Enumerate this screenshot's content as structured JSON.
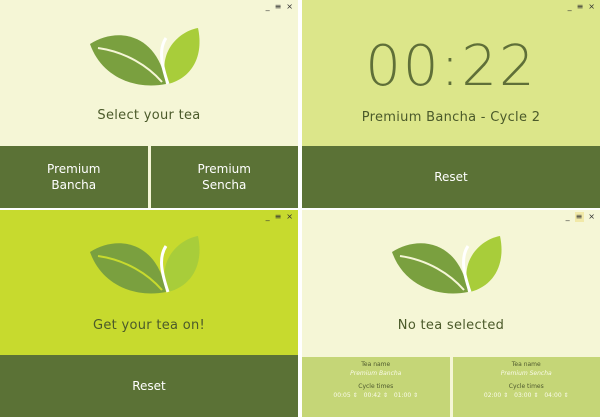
{
  "window_controls": {
    "minimize": "_",
    "menu": "≡",
    "close": "×"
  },
  "panel_select": {
    "message": "Select your tea",
    "buttons": [
      "Premium\nBancha",
      "Premium\nSencha"
    ]
  },
  "panel_timer": {
    "time": "00:22",
    "status": "Premium Bancha - Cycle 2",
    "reset_label": "Reset"
  },
  "panel_done": {
    "message": "Get your tea on!",
    "reset_label": "Reset"
  },
  "panel_none": {
    "message": "No tea selected",
    "cols": [
      {
        "tea_name_label": "Tea name",
        "tea_name": "Premium Bancha",
        "cycle_label": "Cycle times",
        "times": [
          "00:05 ⇕",
          "00:42 ⇕",
          "01:00 ⇕"
        ]
      },
      {
        "tea_name_label": "Tea name",
        "tea_name": "Premium Sencha",
        "cycle_label": "Cycle times",
        "times": [
          "02:00 ⇕",
          "03:00 ⇕",
          "04:00 ⇕"
        ]
      }
    ]
  },
  "colors": {
    "leaf_dark": "#7aa03f",
    "leaf_light": "#a8cd3a",
    "button_dark": "#5b7236",
    "cream_bg": "#f5f6d6",
    "lime_bg": "#c7da2e",
    "timer_bg": "#dce68a"
  }
}
